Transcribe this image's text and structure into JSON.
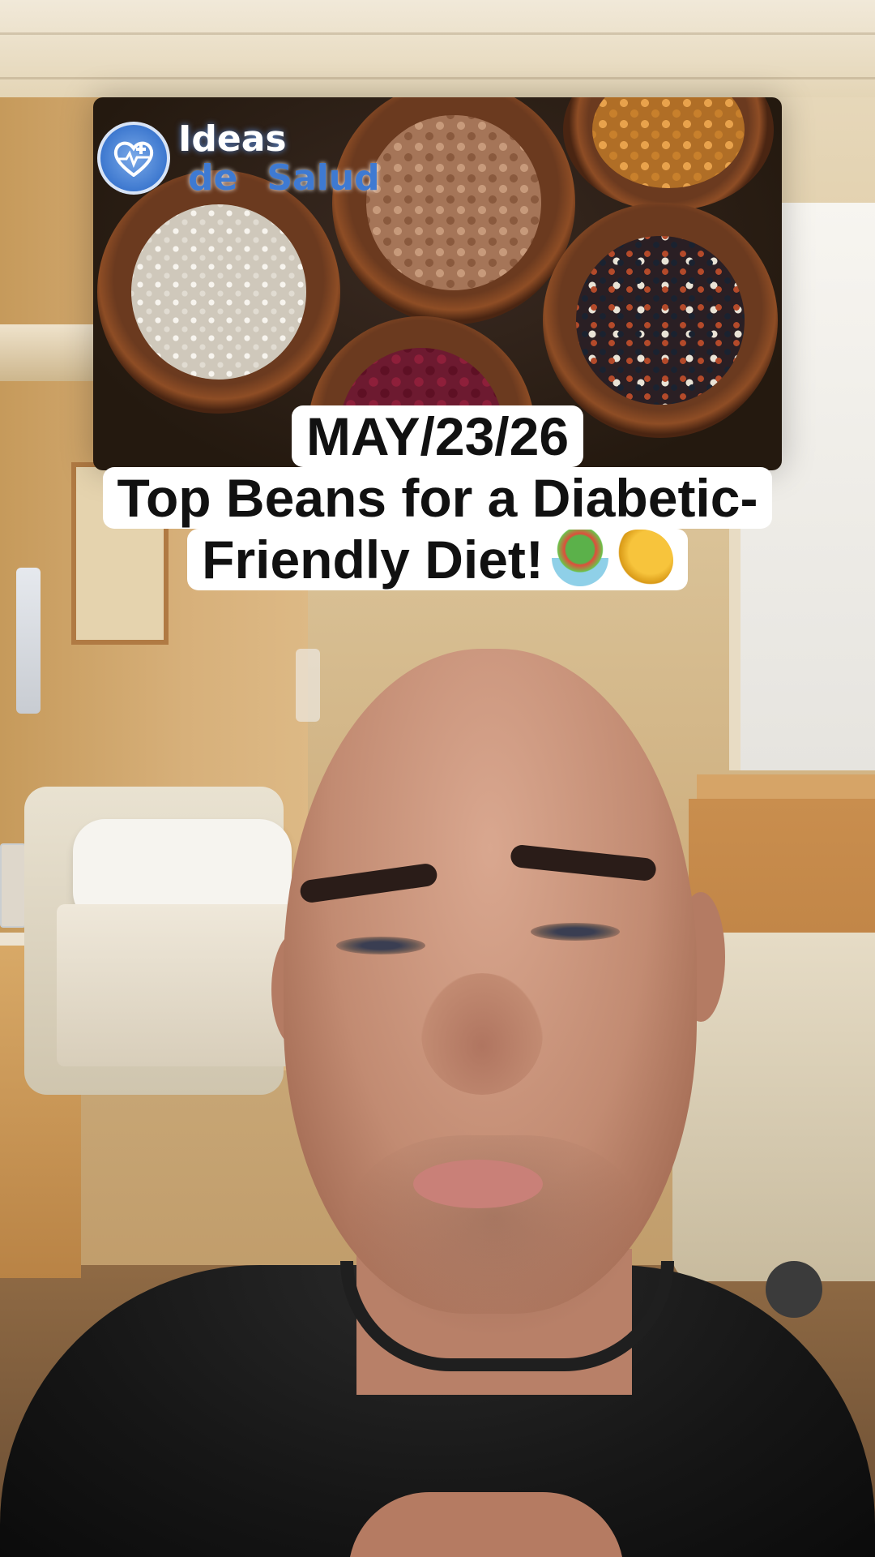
{
  "brand": {
    "line1": "Ideas",
    "line2_a": "de",
    "line2_b": "Salud",
    "logo_icon": "heart-medical-cross-icon"
  },
  "caption": {
    "line1": "MAY/23/26",
    "line2": "Top Beans for a Diabetic-",
    "line3": "Friendly Diet!",
    "emojis": [
      "salad-emoji",
      "flexed-biceps-emoji"
    ]
  },
  "colors": {
    "caption_bg": "#ffffff",
    "caption_text": "#111111",
    "brand_blue": "#3e7ad2"
  }
}
